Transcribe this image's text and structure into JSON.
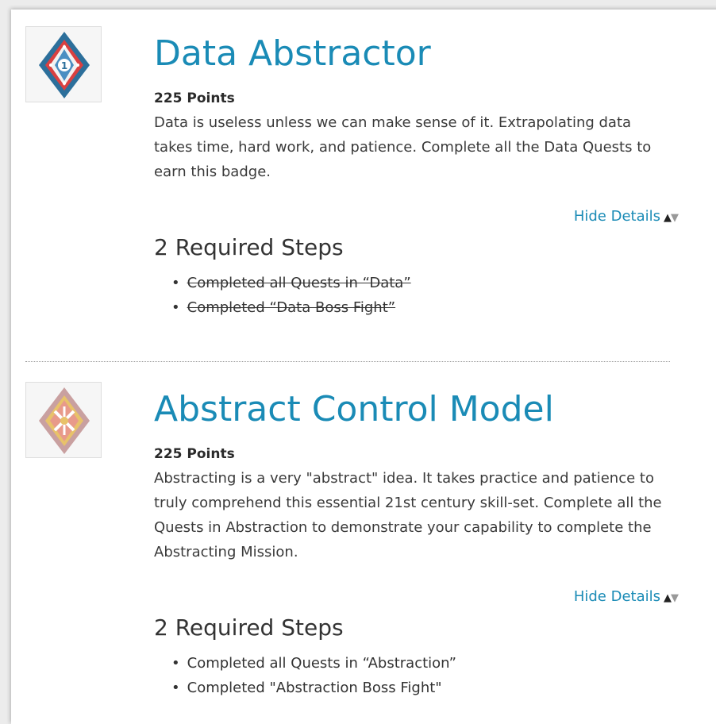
{
  "badges": [
    {
      "title": "Data Abstractor",
      "points": "225 Points",
      "description": "Data is useless unless we can make sense of it. Extrapolating data takes time, hard work, and patience. Complete all the Data Quests to earn this badge.",
      "toggle_label": "Hide Details",
      "steps_title": "2 Required Steps",
      "steps_completed": true,
      "steps": [
        "Completed all Quests in “Data”",
        "Completed “Data Boss Fight”"
      ],
      "badge_icon": "data-abstractor-badge-icon",
      "badge_colors": {
        "primary": "#2c6f9b",
        "accent": "#d94040"
      }
    },
    {
      "title": "Abstract Control Model",
      "points": "225 Points",
      "description": "Abstracting is a very \"abstract\" idea. It takes practice and patience to truly comprehend this essential 21st century skill-set. Complete all the Quests in Abstraction to demonstrate your capability to complete the Abstracting Mission.",
      "toggle_label": "Hide Details",
      "steps_title": "2 Required Steps",
      "steps_completed": false,
      "steps": [
        "Completed all Quests in “Abstraction”",
        "Completed \"Abstraction Boss Fight\""
      ],
      "badge_icon": "abstract-control-model-badge-icon",
      "badge_colors": {
        "primary": "#c9a0a0",
        "accent": "#e8c26a"
      }
    }
  ]
}
